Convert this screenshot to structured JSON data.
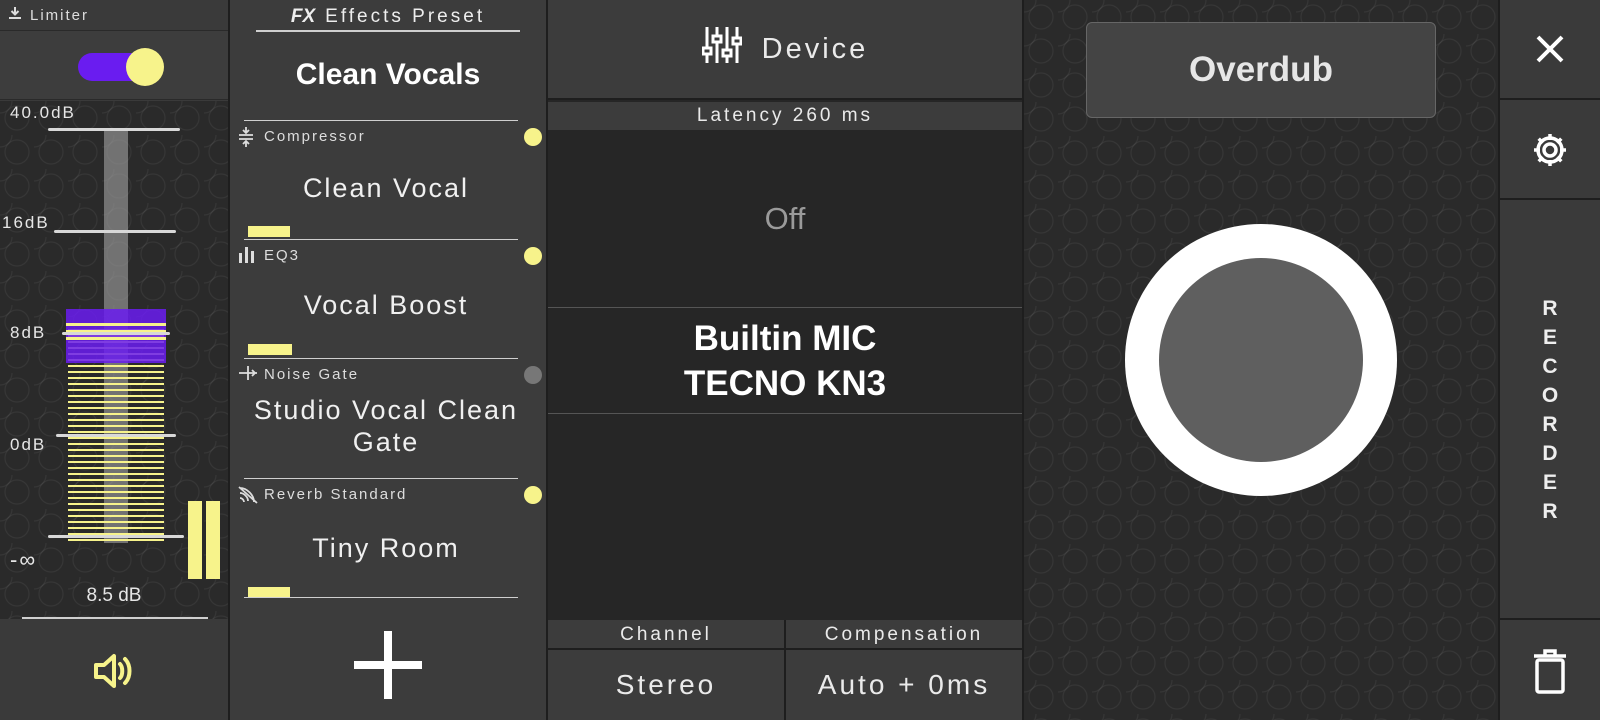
{
  "limiter": {
    "header": "Limiter",
    "enabled": true,
    "scale": [
      "40.0dB",
      "16dB",
      "8dB",
      "0dB",
      "-∞"
    ],
    "readout": "8.5 dB",
    "colors": {
      "accent": "#6a1cf0",
      "meter": "#f7f38b"
    }
  },
  "effects": {
    "title": "Effects Preset",
    "fx_badge": "FX",
    "preset_name": "Clean Vocals",
    "items": [
      {
        "name": "Compressor",
        "value": "Clean Vocal",
        "active": true,
        "level": 0.14
      },
      {
        "name": "EQ3",
        "value": "Vocal Boost",
        "active": true,
        "level": 0.15
      },
      {
        "name": "Noise Gate",
        "value": "Studio Vocal Clean Gate",
        "active": false,
        "level": 0
      },
      {
        "name": "Reverb Standard",
        "value": "Tiny Room",
        "active": true,
        "level": 0.14
      }
    ]
  },
  "device": {
    "title": "Device",
    "latency": "Latency 260 ms",
    "monitor": "Off",
    "input_line1": "Builtin MIC",
    "input_line2": "TECNO KN3",
    "channel_label": "Channel",
    "channel_value": "Stereo",
    "compensation_label": "Compensation",
    "compensation_value": "Auto + 0ms"
  },
  "recorder": {
    "mode": "Overdub",
    "side_label": "RECORDER"
  }
}
